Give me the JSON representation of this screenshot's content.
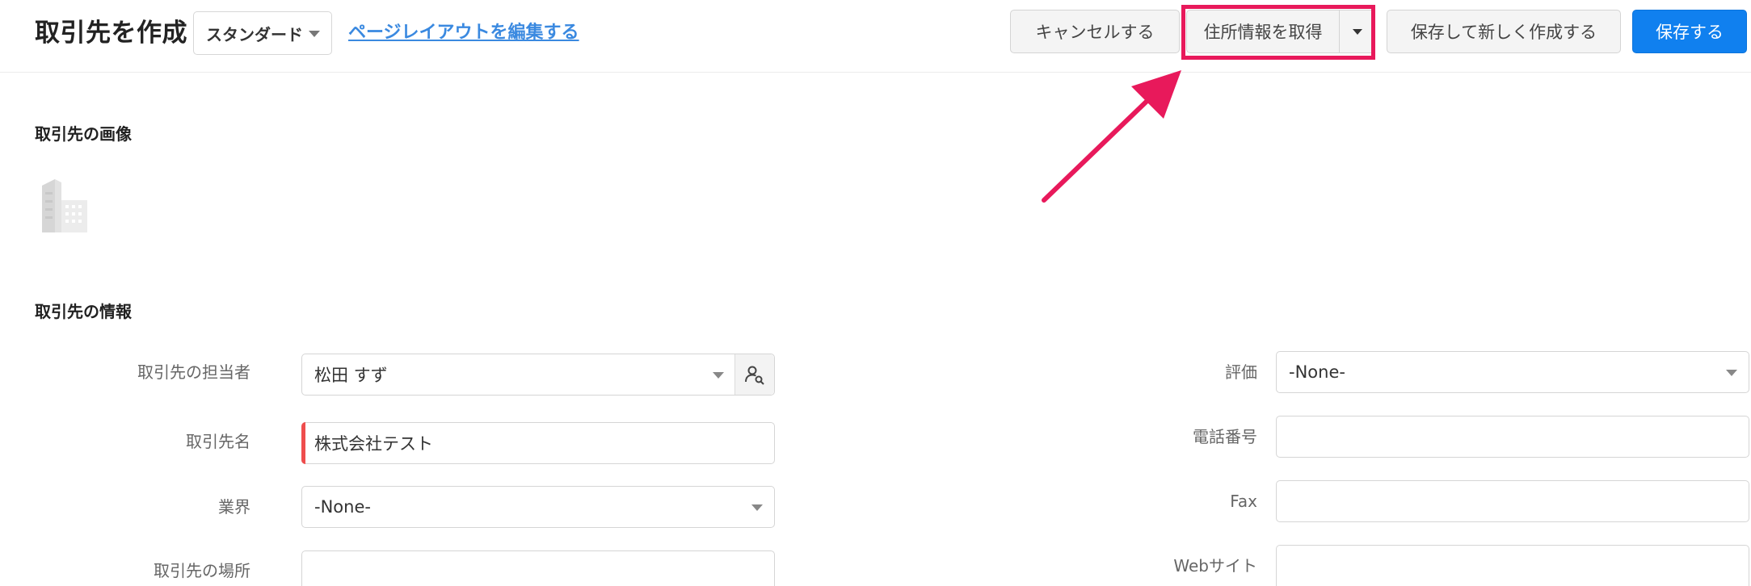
{
  "header": {
    "title": "取引先を作成",
    "layout_select_value": "スタンダード",
    "edit_layout_link": "ページレイアウトを編集する",
    "buttons": {
      "cancel": "キャンセルする",
      "get_address": "住所情報を取得",
      "save_and_new": "保存して新しく作成する",
      "save": "保存する"
    }
  },
  "sections": {
    "image_title": "取引先の画像",
    "info_title": "取引先の情報"
  },
  "left_fields": {
    "owner": {
      "label": "取引先の担当者",
      "value": "松田 すず"
    },
    "name": {
      "label": "取引先名",
      "value": "株式会社テスト"
    },
    "industry": {
      "label": "業界",
      "value": "-None-"
    },
    "location": {
      "label": "取引先の場所",
      "value": ""
    }
  },
  "right_fields": {
    "rating": {
      "label": "評価",
      "value": "-None-"
    },
    "phone": {
      "label": "電話番号",
      "value": ""
    },
    "fax": {
      "label": "Fax",
      "value": ""
    },
    "website": {
      "label": "Webサイト",
      "value": ""
    }
  },
  "colors": {
    "primary": "#1080ef",
    "link": "#3a89e0",
    "highlight": "#e8195b",
    "required": "#ef4d4d"
  },
  "icons": {
    "account_image": "building-icon",
    "owner_lookup": "user-search-icon",
    "dropdown": "caret-down-icon",
    "callout": "arrow-icon"
  }
}
